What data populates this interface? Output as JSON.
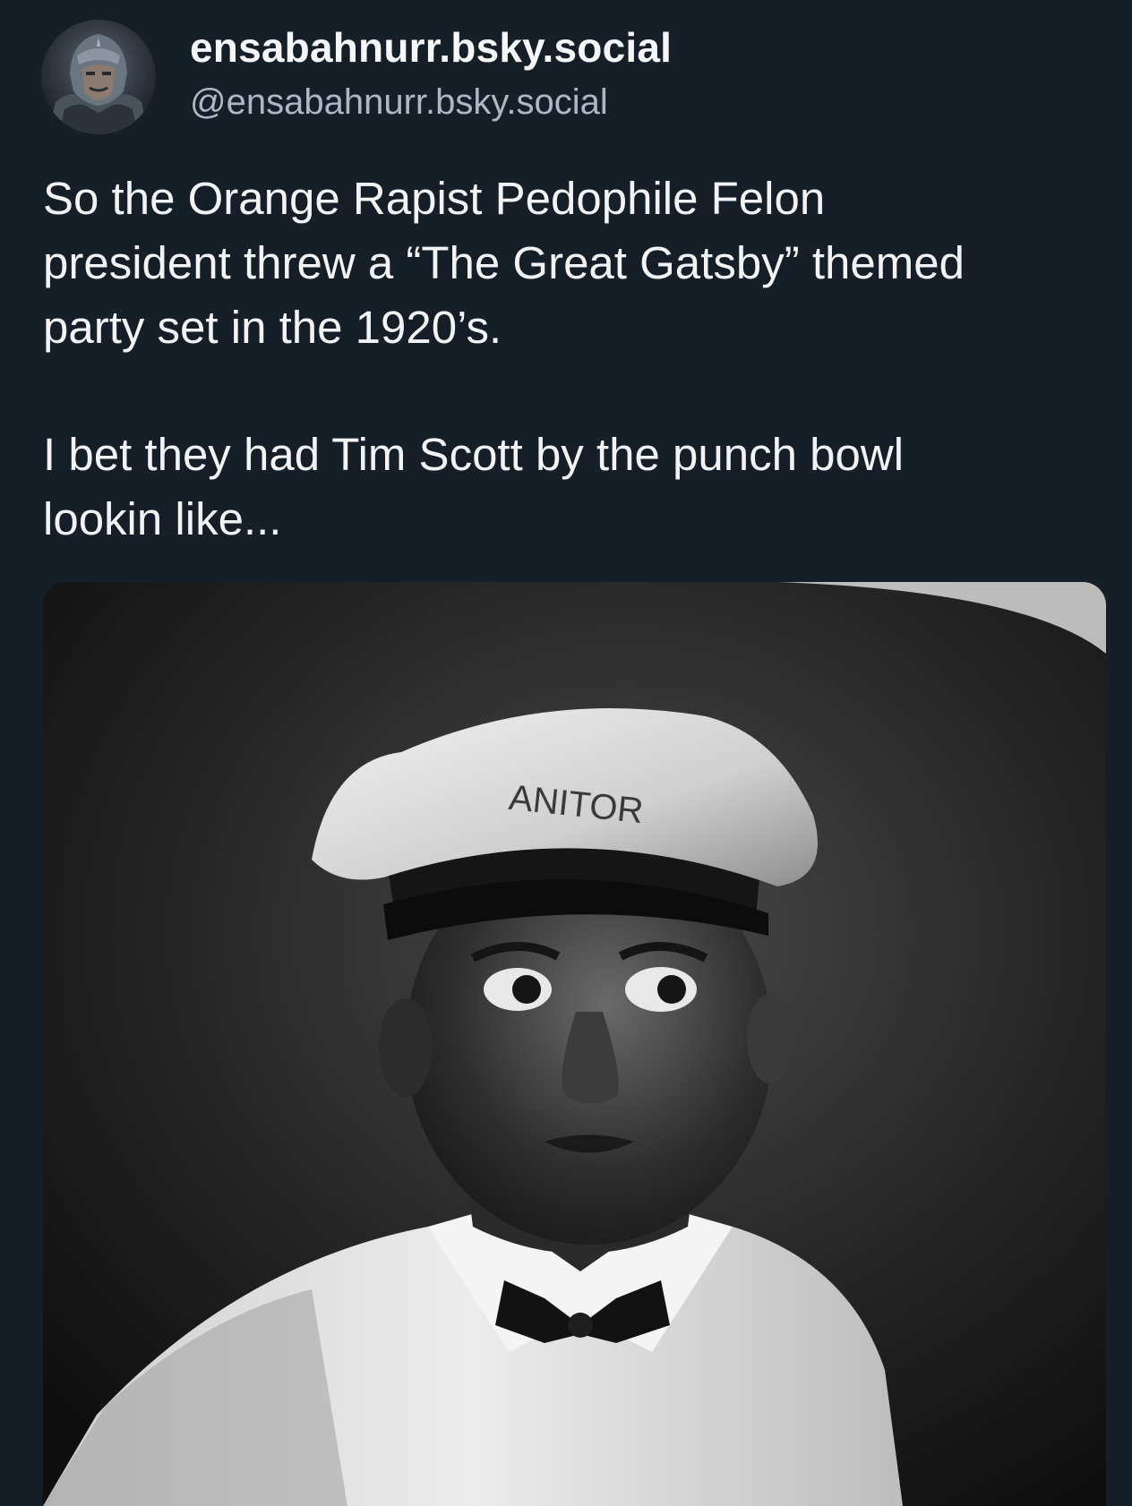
{
  "post": {
    "author": {
      "display_name": "ensabahnurr.bsky.social",
      "handle": "@ensabahnurr.bsky.social"
    },
    "paragraphs": [
      {
        "lines": [
          "So the Orange Rapist Pedophile Felon",
          "president threw a “The Great Gatsby” themed",
          "party set in the 1920’s."
        ]
      },
      {
        "lines": [
          "I bet they had Tim Scott by the punch bowl",
          "lookin like..."
        ]
      }
    ],
    "image": {
      "cap_text": "ANITOR"
    }
  },
  "colors": {
    "background": "#161e27",
    "text": "#f1f3f5",
    "handle": "#aeb8c4"
  }
}
